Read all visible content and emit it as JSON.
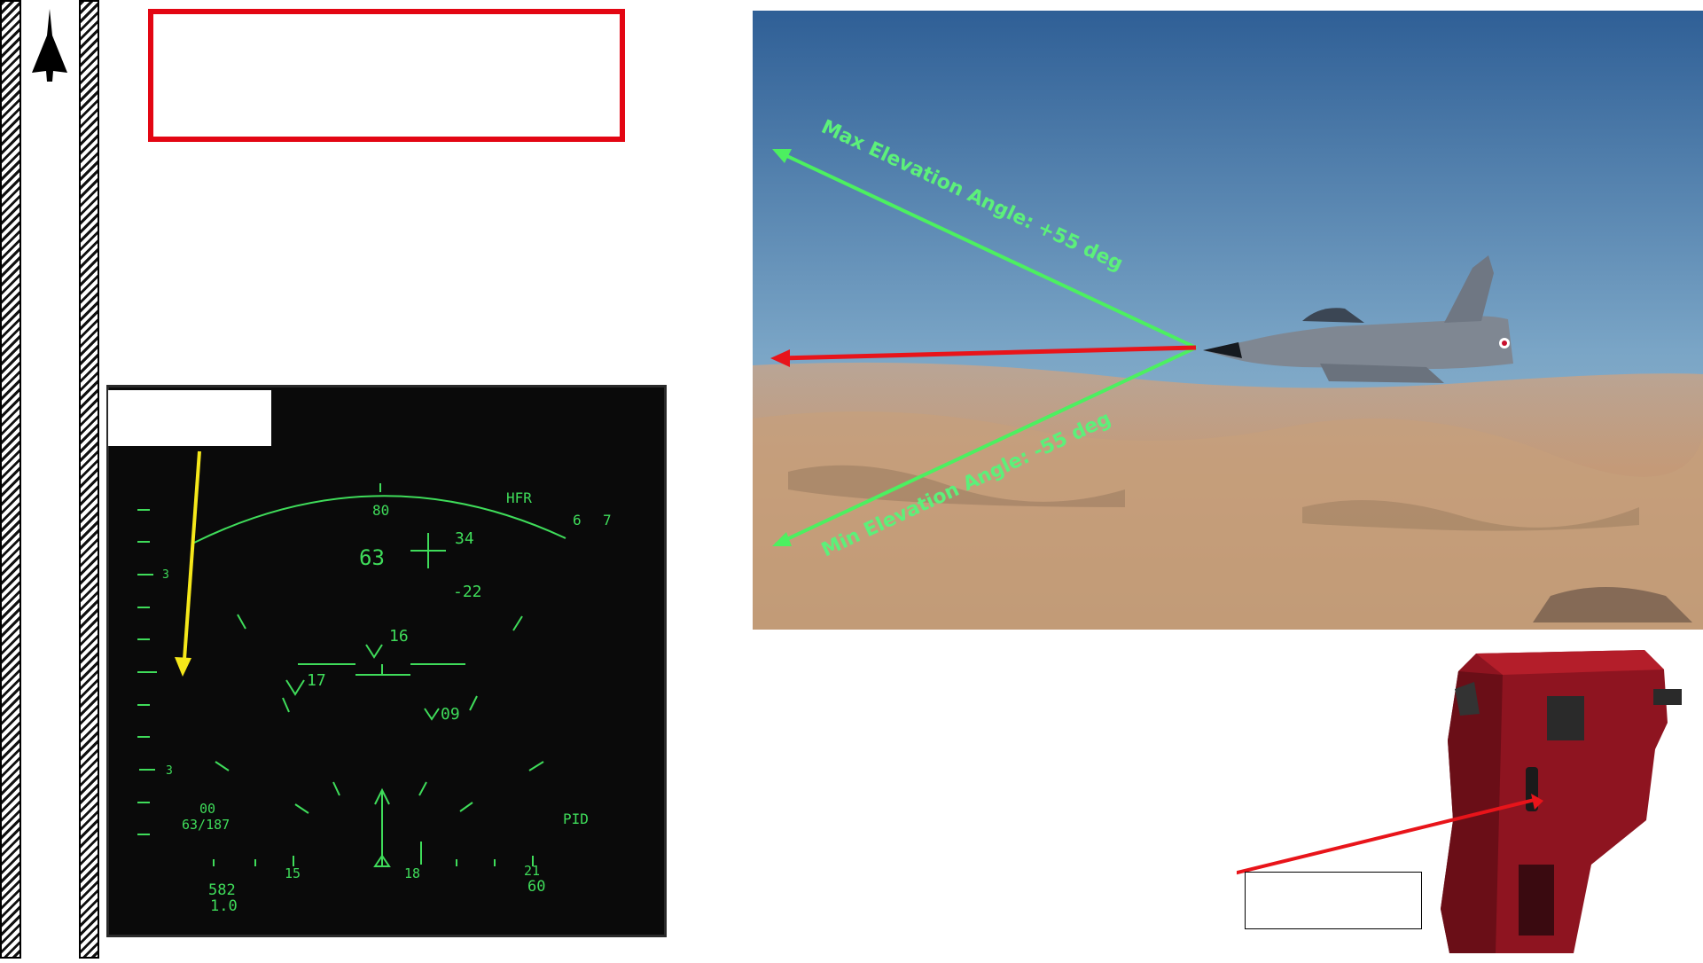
{
  "hud": {
    "radar_mode": "HFR",
    "heading_top": "80",
    "corner_numbers": [
      "6",
      "7"
    ],
    "altitude_big": "63",
    "elevation_top": "34",
    "elevation_bottom": "-22",
    "target_a": "16",
    "target_b": "17",
    "target_c": "09",
    "scale_mark_upper": "3",
    "scale_mark_lower": "3",
    "range_top": "00",
    "range_ratio": "63/187",
    "pid": "PID",
    "heading_ticks": [
      "15",
      "18",
      "21"
    ],
    "speed": "582",
    "mach": "1.0",
    "bottom_right": "60"
  },
  "photo": {
    "max_label": "Max Elevation Angle: +55 deg",
    "min_label": "Min Elevation Angle: -55 deg",
    "colors": {
      "elevation_arrow": "#4cf060",
      "boresight_arrow": "#e8141a"
    }
  },
  "colors": {
    "title_box_border": "#e30613",
    "hud_symbology": "#3fdc5a",
    "callout_arrow": "#f5e71a"
  }
}
